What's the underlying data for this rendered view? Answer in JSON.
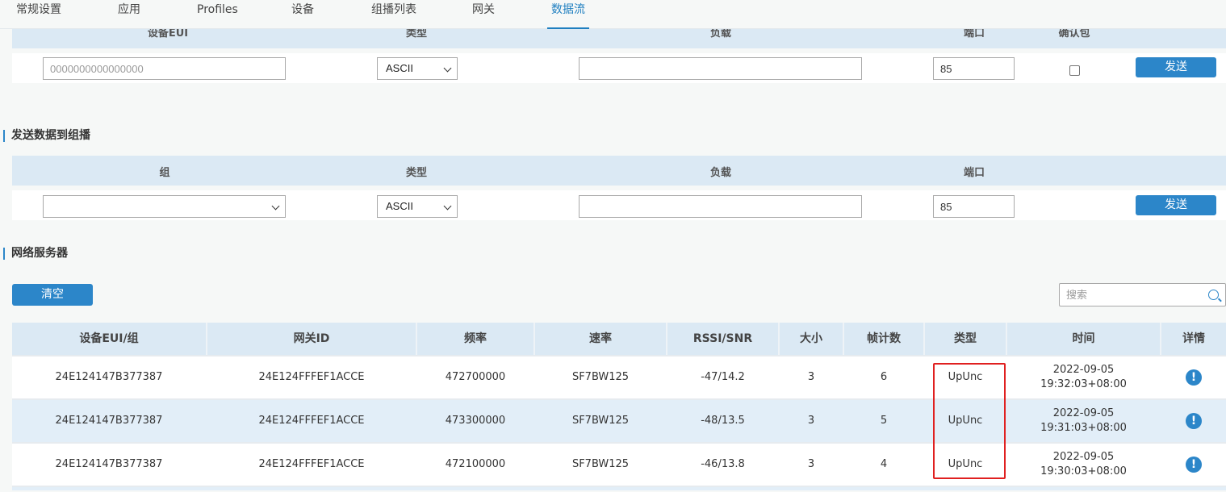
{
  "nav": {
    "tabs": [
      {
        "label": "常规设置"
      },
      {
        "label": "应用"
      },
      {
        "label": "Profiles"
      },
      {
        "label": "设备"
      },
      {
        "label": "组播列表"
      },
      {
        "label": "网关"
      },
      {
        "label": "数据流"
      }
    ],
    "active": "数据流"
  },
  "device_send": {
    "headers": [
      "设备EUI",
      "类型",
      "负载",
      "端口",
      "确认包"
    ],
    "eui_placeholder": "0000000000000000",
    "type_value": "ASCII",
    "payload_value": "",
    "port_value": "85",
    "confirmed": false,
    "send_label": "发送"
  },
  "multicast_send": {
    "title": "发送数据到组播",
    "headers": [
      "组",
      "类型",
      "负载",
      "端口"
    ],
    "group_value": "",
    "type_value": "ASCII",
    "payload_value": "",
    "port_value": "85",
    "send_label": "发送"
  },
  "network_server": {
    "title": "网络服务器",
    "clear_label": "清空",
    "search_placeholder": "搜索",
    "columns": [
      "设备EUI/组",
      "网关ID",
      "频率",
      "速率",
      "RSSI/SNR",
      "大小",
      "帧计数",
      "类型",
      "时间",
      "详情"
    ],
    "rows": [
      {
        "eui": "24E124147B377387",
        "gateway": "24E124FFFEF1ACCE",
        "freq": "472700000",
        "rate": "SF7BW125",
        "rssi": "-47/14.2",
        "size": "3",
        "fcnt": "6",
        "type": "UpUnc",
        "date": "2022-09-05",
        "time": "19:32:03+08:00"
      },
      {
        "eui": "24E124147B377387",
        "gateway": "24E124FFFEF1ACCE",
        "freq": "473300000",
        "rate": "SF7BW125",
        "rssi": "-48/13.5",
        "size": "3",
        "fcnt": "5",
        "type": "UpUnc",
        "date": "2022-09-05",
        "time": "19:31:03+08:00"
      },
      {
        "eui": "24E124147B377387",
        "gateway": "24E124FFFEF1ACCE",
        "freq": "472100000",
        "rate": "SF7BW125",
        "rssi": "-46/13.8",
        "size": "3",
        "fcnt": "4",
        "type": "UpUnc",
        "date": "2022-09-05",
        "time": "19:30:03+08:00"
      }
    ],
    "detail_icon": "info-icon"
  },
  "colors": {
    "accent": "#2c86c9",
    "header_bg": "#dbe9f4",
    "highlight": "#e02020"
  }
}
